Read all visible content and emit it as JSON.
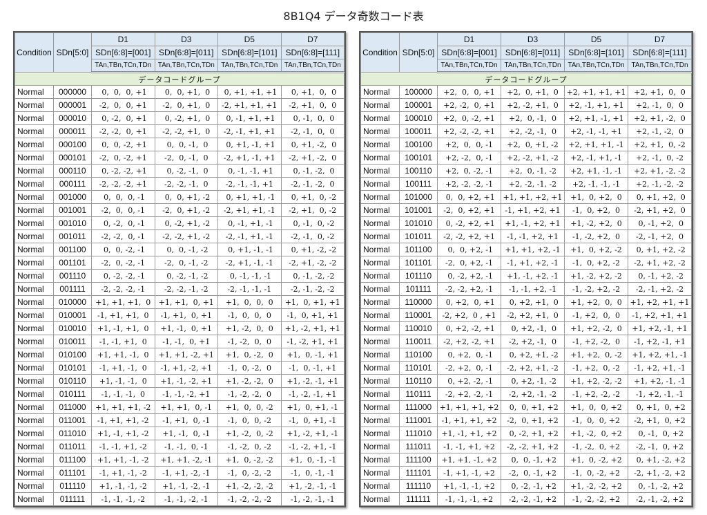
{
  "title": "8B1Q4 データ奇数コード表",
  "headers": {
    "condition": "Condition",
    "sdn50": "SDn[5:0]",
    "group_label": "データコードグループ",
    "columns": [
      {
        "name": "D1",
        "sel": "SDn[6:8]=[001]",
        "sub": "TAn,TBn,TCn,TDn"
      },
      {
        "name": "D3",
        "sel": "SDn[6:8]=[011]",
        "sub": "TAn,TBn,TCn,TDn"
      },
      {
        "name": "D5",
        "sel": "SDn[6:8]=[101]",
        "sub": "TAn,TBn,TCn,TDn"
      },
      {
        "name": "D7",
        "sel": "SDn[6:8]=[111]",
        "sub": "TAn,TBn,TCn,TDn"
      }
    ]
  },
  "left_rows": [
    {
      "cond": "Normal",
      "sd": "000000",
      "d1": " 0,  0,  0, +1",
      "d3": " 0,  0, +1,  0",
      "d5": " 0, +1, +1, +1",
      "d7": " 0, +1,  0,  0"
    },
    {
      "cond": "Normal",
      "sd": "000001",
      "d1": "-2,  0,  0, +1",
      "d3": "-2,  0, +1,  0",
      "d5": "-2, +1, +1, +1",
      "d7": "-2, +1,  0,  0"
    },
    {
      "cond": "Normal",
      "sd": "000010",
      "d1": " 0, -2,  0, +1",
      "d3": " 0, -2, +1,  0",
      "d5": " 0, -1, +1, +1",
      "d7": " 0, -1,  0,  0"
    },
    {
      "cond": "Normal",
      "sd": "000011",
      "d1": "-2, -2,  0, +1",
      "d3": "-2, -2, +1,  0",
      "d5": "-2, -1, +1, +1",
      "d7": "-2, -1,  0,  0"
    },
    {
      "cond": "Normal",
      "sd": "000100",
      "d1": " 0,  0, -2, +1",
      "d3": " 0,  0, -1,  0",
      "d5": " 0, +1, -1, +1",
      "d7": " 0, +1, -2,  0"
    },
    {
      "cond": "Normal",
      "sd": "000101",
      "d1": "-2,  0, -2, +1",
      "d3": "-2,  0, -1,  0",
      "d5": "-2, +1, -1, +1",
      "d7": "-2, +1, -2,  0"
    },
    {
      "cond": "Normal",
      "sd": "000110",
      "d1": " 0, -2, -2, +1",
      "d3": " 0, -2, -1,  0",
      "d5": " 0, -1, -1, +1",
      "d7": " 0, -1, -2,  0"
    },
    {
      "cond": "Normal",
      "sd": "000111",
      "d1": "-2, -2, -2, +1",
      "d3": "-2, -2, -1,  0",
      "d5": "-2, -1, -1, +1",
      "d7": "-2, -1, -2,  0"
    },
    {
      "cond": "Normal",
      "sd": "001000",
      "d1": " 0,  0,  0, -1",
      "d3": " 0,  0, +1, -2",
      "d5": " 0, +1, +1, -1",
      "d7": " 0, +1,  0, -2"
    },
    {
      "cond": "Normal",
      "sd": "001001",
      "d1": "-2,  0,  0, -1",
      "d3": "-2,  0, +1, -2",
      "d5": "-2, +1, +1, -1",
      "d7": "-2, +1,  0, -2"
    },
    {
      "cond": "Normal",
      "sd": "001010",
      "d1": " 0, -2,  0, -1",
      "d3": " 0, -2, +1, -2",
      "d5": " 0, -1, +1, -1",
      "d7": " 0, -1,  0, -2"
    },
    {
      "cond": "Normal",
      "sd": "001011",
      "d1": "-2, -2,  0, -1",
      "d3": "-2, -2, +1, -2",
      "d5": "-2, -1, +1, -1",
      "d7": "-2, -1,  0, -2"
    },
    {
      "cond": "Normal",
      "sd": "001100",
      "d1": " 0,  0, -2, -1",
      "d3": " 0,  0, -1, -2",
      "d5": " 0, +1, -1, -1",
      "d7": " 0, +1, -2, -2"
    },
    {
      "cond": "Normal",
      "sd": "001101",
      "d1": "-2,  0, -2, -1",
      "d3": "-2,  0, -1, -2",
      "d5": "-2, +1, -1, -1",
      "d7": "-2, +1, -2, -2"
    },
    {
      "cond": "Normal",
      "sd": "001110",
      "d1": " 0, -2, -2, -1",
      "d3": " 0, -2, -1, -2",
      "d5": " 0, -1, -1, -1",
      "d7": " 0, -1, -2, -2"
    },
    {
      "cond": "Normal",
      "sd": "001111",
      "d1": "-2, -2, -2, -1",
      "d3": "-2, -2, -1, -2",
      "d5": "-2, -1, -1, -1",
      "d7": "-2, -1, -2, -2"
    },
    {
      "cond": "Normal",
      "sd": "010000",
      "d1": "+1, +1, +1,  0",
      "d3": "+1, +1,  0, +1",
      "d5": "+1,  0,  0,  0",
      "d7": "+1,  0, +1, +1"
    },
    {
      "cond": "Normal",
      "sd": "010001",
      "d1": "-1, +1, +1,  0",
      "d3": "-1, +1,  0, +1",
      "d5": "-1,  0,  0,  0",
      "d7": "-1,  0, +1, +1"
    },
    {
      "cond": "Normal",
      "sd": "010010",
      "d1": "+1, -1, +1,  0",
      "d3": "+1, -1,  0, +1",
      "d5": "+1, -2,  0,  0",
      "d7": "+1, -2, +1, +1"
    },
    {
      "cond": "Normal",
      "sd": "010011",
      "d1": "-1, -1, +1,  0",
      "d3": "-1, -1,  0, +1",
      "d5": "-1, -2,  0,  0",
      "d7": "-1, -2, +1, +1"
    },
    {
      "cond": "Normal",
      "sd": "010100",
      "d1": "+1, +1, -1,  0",
      "d3": "+1, +1, -2, +1",
      "d5": "+1,  0, -2,  0",
      "d7": "+1,  0, -1, +1"
    },
    {
      "cond": "Normal",
      "sd": "010101",
      "d1": "-1, +1, -1,  0",
      "d3": "-1, +1, -2, +1",
      "d5": "-1,  0, -2,  0",
      "d7": "-1,  0, -1, +1"
    },
    {
      "cond": "Normal",
      "sd": "010110",
      "d1": "+1, -1, -1,  0",
      "d3": "+1, -1, -2, +1",
      "d5": "+1, -2, -2,  0",
      "d7": "+1, -2, -1, +1"
    },
    {
      "cond": "Normal",
      "sd": "010111",
      "d1": "-1, -1, -1,  0",
      "d3": "-1, -1, -2, +1",
      "d5": "-1, -2, -2,  0",
      "d7": "-1, -2, -1, +1"
    },
    {
      "cond": "Normal",
      "sd": "011000",
      "d1": "+1, +1, +1, -2",
      "d3": "+1, +1,  0, -1",
      "d5": "+1,  0,  0, -2",
      "d7": "+1,  0, +1, -1"
    },
    {
      "cond": "Normal",
      "sd": "011001",
      "d1": "-1, +1, +1, -2",
      "d3": "-1, +1,  0, -1",
      "d5": "-1,  0,  0, -2",
      "d7": "-1,  0, +1, -1"
    },
    {
      "cond": "Normal",
      "sd": "011010",
      "d1": "+1, -1, +1, -2",
      "d3": "+1, -1,  0, -1",
      "d5": "+1, -2,  0, -2",
      "d7": "+1, -2, +1, -1"
    },
    {
      "cond": "Normal",
      "sd": "011011",
      "d1": "-1, -1, +1, -2",
      "d3": "-1, -1,  0, -1",
      "d5": "-1, -2,  0, -2",
      "d7": "-1, -2, +1, -1"
    },
    {
      "cond": "Normal",
      "sd": "011100",
      "d1": "+1, +1, -1, -2",
      "d3": "+1, +1, -2, -1",
      "d5": "+1,  0, -2, -2",
      "d7": "+1,  0, -1, -1"
    },
    {
      "cond": "Normal",
      "sd": "011101",
      "d1": "-1, +1, -1, -2",
      "d3": "-1, +1, -2, -1",
      "d5": "-1,  0, -2, -2",
      "d7": "-1,  0, -1, -1"
    },
    {
      "cond": "Normal",
      "sd": "011110",
      "d1": "+1, -1, -1, -2",
      "d3": "+1, -1, -2, -1",
      "d5": "+1, -2, -2, -2",
      "d7": "+1, -2, -1, -1"
    },
    {
      "cond": "Normal",
      "sd": "011111",
      "d1": "-1, -1, -1, -2",
      "d3": "-1, -1, -2, -1",
      "d5": "-1, -2, -2, -2",
      "d7": "-1, -2, -1, -1"
    }
  ],
  "right_rows": [
    {
      "cond": "Normal",
      "sd": "100000",
      "d1": "+2,  0,  0, +1",
      "d3": "+2,  0, +1,  0",
      "d5": "+2, +1, +1, +1",
      "d7": "+2, +1,  0,  0"
    },
    {
      "cond": "Normal",
      "sd": "100001",
      "d1": "+2, -2,  0, +1",
      "d3": "+2, -2, +1,  0",
      "d5": "+2, -1, +1, +1",
      "d7": "+2, -1,  0,  0"
    },
    {
      "cond": "Normal",
      "sd": "100010",
      "d1": "+2,  0, -2, +1",
      "d3": "+2,  0, -1,  0",
      "d5": "+2, +1, -1, +1",
      "d7": "+2, +1, -2,  0"
    },
    {
      "cond": "Normal",
      "sd": "100011",
      "d1": "+2, -2, -2, +1",
      "d3": "+2, -2, -1,  0",
      "d5": "+2, -1, -1, +1",
      "d7": "+2, -1, -2,  0"
    },
    {
      "cond": "Normal",
      "sd": "100100",
      "d1": "+2,  0,  0, -1",
      "d3": "+2,  0, +1, -2",
      "d5": "+2, +1, +1, -1",
      "d7": "+2, +1,  0, -2"
    },
    {
      "cond": "Normal",
      "sd": "100101",
      "d1": "+2, -2,  0, -1",
      "d3": "+2, -2, +1, -2",
      "d5": "+2, -1, +1, -1",
      "d7": "+2, -1,  0, -2"
    },
    {
      "cond": "Normal",
      "sd": "100110",
      "d1": "+2,  0, -2, -1",
      "d3": "+2,  0, -1, -2",
      "d5": "+2, +1, -1, -1",
      "d7": "+2, +1, -2, -2"
    },
    {
      "cond": "Normal",
      "sd": "100111",
      "d1": "+2, -2, -2, -1",
      "d3": "+2, -2, -1, -2",
      "d5": "+2, -1, -1, -1",
      "d7": "+2, -1, -2, -2"
    },
    {
      "cond": "Normal",
      "sd": "101000",
      "d1": " 0,  0, +2, +1",
      "d3": "+1, +1, +2, +1",
      "d5": "+1,  0, +2,  0",
      "d7": " 0, +1, +2,  0"
    },
    {
      "cond": "Normal",
      "sd": "101001",
      "d1": "-2,  0, +2, +1",
      "d3": "-1, +1, +2, +1",
      "d5": "-1,  0, +2,  0",
      "d7": "-2, +1, +2,  0"
    },
    {
      "cond": "Normal",
      "sd": "101010",
      "d1": " 0, -2, +2, +1",
      "d3": "+1, -1, +2, +1",
      "d5": "+1, -2, +2,  0",
      "d7": " 0, -1, +2,  0"
    },
    {
      "cond": "Normal",
      "sd": "101011",
      "d1": "-2, -2, +2, +1",
      "d3": "-1, -1, +2, +1",
      "d5": "-1, -2, +2,  0",
      "d7": "-2, -1, +2,  0"
    },
    {
      "cond": "Normal",
      "sd": "101100",
      "d1": " 0,  0, +2, -1",
      "d3": "+1, +1, +2, -1",
      "d5": "+1,  0, +2, -2",
      "d7": " 0, +1, +2, -2"
    },
    {
      "cond": "Normal",
      "sd": "101101",
      "d1": "-2,  0, +2, -1",
      "d3": "-1, +1, +2, -1",
      "d5": "-1,  0, +2, -2",
      "d7": "-2, +1, +2, -2"
    },
    {
      "cond": "Normal",
      "sd": "101110",
      "d1": " 0, -2, +2, -1",
      "d3": "+1, -1, +2, -1",
      "d5": "+1, -2, +2, -2",
      "d7": " 0, -1, +2, -2"
    },
    {
      "cond": "Normal",
      "sd": "101111",
      "d1": "-2, -2, +2, -1",
      "d3": "-1, -1, +2, -1",
      "d5": "-1, -2, +2, -2",
      "d7": "-2, -1, +2, -2"
    },
    {
      "cond": "Normal",
      "sd": "110000",
      "d1": " 0, +2,  0, +1",
      "d3": " 0, +2, +1,  0",
      "d5": "+1, +2,  0,  0",
      "d7": "+1, +2, +1, +1"
    },
    {
      "cond": "Normal",
      "sd": "110001",
      "d1": "-2, +2,  0 , +1",
      "d3": "-2, +2, +1,  0",
      "d5": "-1, +2,  0,  0",
      "d7": "-1, +2, +1, +1"
    },
    {
      "cond": "Normal",
      "sd": "110010",
      "d1": " 0, +2, -2, +1",
      "d3": " 0, +2, -1,  0",
      "d5": "+1, +2, -2,  0",
      "d7": "+1, +2, -1, +1"
    },
    {
      "cond": "Normal",
      "sd": "110011",
      "d1": "-2, +2, -2, +1",
      "d3": "-2, +2, -1,  0",
      "d5": "-1, +2, -2,  0",
      "d7": "-1, +2, -1, +1"
    },
    {
      "cond": "Normal",
      "sd": "110100",
      "d1": " 0, +2,  0, -1",
      "d3": " 0, +2, +1, -2",
      "d5": "+1, +2,  0, -2",
      "d7": "+1, +2, +1, -1"
    },
    {
      "cond": "Normal",
      "sd": "110101",
      "d1": "-2, +2,  0, -1",
      "d3": "-2, +2, +1, -2",
      "d5": "-1, +2,  0, -2",
      "d7": "-1, +2, +1, -1"
    },
    {
      "cond": "Normal",
      "sd": "110110",
      "d1": " 0, +2, -2, -1",
      "d3": " 0, +2, -1, -2",
      "d5": "+1, +2, -2, -2",
      "d7": "+1, +2, -1, -1"
    },
    {
      "cond": "Normal",
      "sd": "110111",
      "d1": "-2, +2, -2, -1",
      "d3": "-2, +2, -1, -2",
      "d5": "-1, +2, -2, -2",
      "d7": "-1, +2, -1, -1"
    },
    {
      "cond": "Normal",
      "sd": "111000",
      "d1": "+1, +1, +1, +2",
      "d3": " 0,  0, +1, +2",
      "d5": "+1,  0,  0, +2",
      "d7": " 0, +1,  0, +2"
    },
    {
      "cond": "Normal",
      "sd": "111001",
      "d1": "-1, +1, +1, +2",
      "d3": "-2,  0, +1, +2",
      "d5": "-1,  0,  0, +2",
      "d7": "-2, +1,  0, +2"
    },
    {
      "cond": "Normal",
      "sd": "111010",
      "d1": "+1, -1, +1, +2",
      "d3": " 0, -2, +1, +2",
      "d5": "+1, -2,  0, +2",
      "d7": " 0, -1,  0, +2"
    },
    {
      "cond": "Normal",
      "sd": "111011",
      "d1": "-1, -1, +1, +2",
      "d3": "-2, -2, +1, +2",
      "d5": "-1, -2,  0, +2",
      "d7": "-2, -1,  0, +2"
    },
    {
      "cond": "Normal",
      "sd": "111100",
      "d1": "+1, +1, -1, +2",
      "d3": " 0,  0, -1, +2",
      "d5": "+1,  0, -2, +2",
      "d7": " 0, +1, -2, +2"
    },
    {
      "cond": "Normal",
      "sd": "111101",
      "d1": "-1, +1, -1, +2",
      "d3": "-2,  0, -1, +2",
      "d5": "-1,  0, -2, +2",
      "d7": "-2, +1, -2, +2"
    },
    {
      "cond": "Normal",
      "sd": "111110",
      "d1": "+1, -1, -1, +2",
      "d3": " 0, -2, -1, +2",
      "d5": "+1, -2, -2, +2",
      "d7": " 0, -1, -2, +2"
    },
    {
      "cond": "Normal",
      "sd": "111111",
      "d1": "-1, -1, -1, +2",
      "d3": "-2, -2, -1, +2",
      "d5": "-1, -2, -2, +2",
      "d7": "-2, -1, -2, +2"
    }
  ]
}
